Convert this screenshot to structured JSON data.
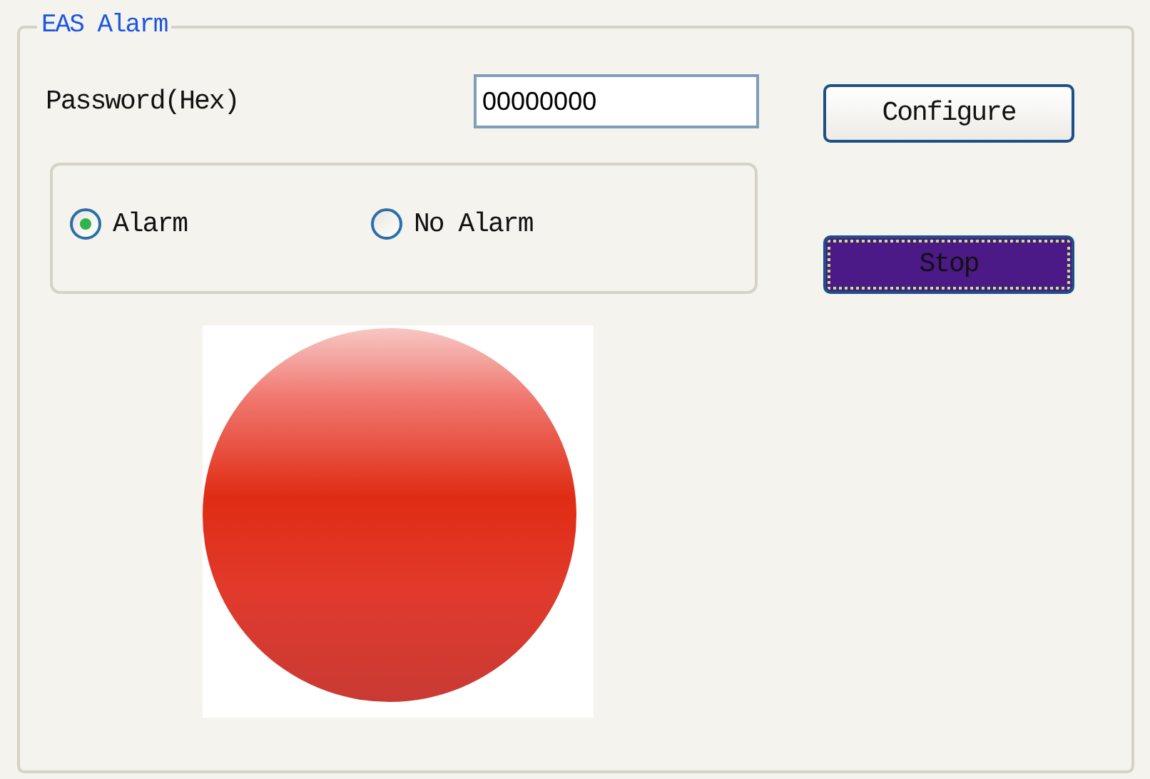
{
  "group": {
    "title": "EAS Alarm"
  },
  "password": {
    "label": "Password(Hex)",
    "value": "00000000"
  },
  "mode": [
    {
      "label": "Alarm",
      "selected": true
    },
    {
      "label": "No Alarm",
      "selected": false
    }
  ],
  "buttons": [
    {
      "label": "Configure",
      "focused": false
    },
    {
      "label": "Stop",
      "focused": true,
      "color": "#4b1a87"
    }
  ],
  "lamp": {
    "on": true
  }
}
